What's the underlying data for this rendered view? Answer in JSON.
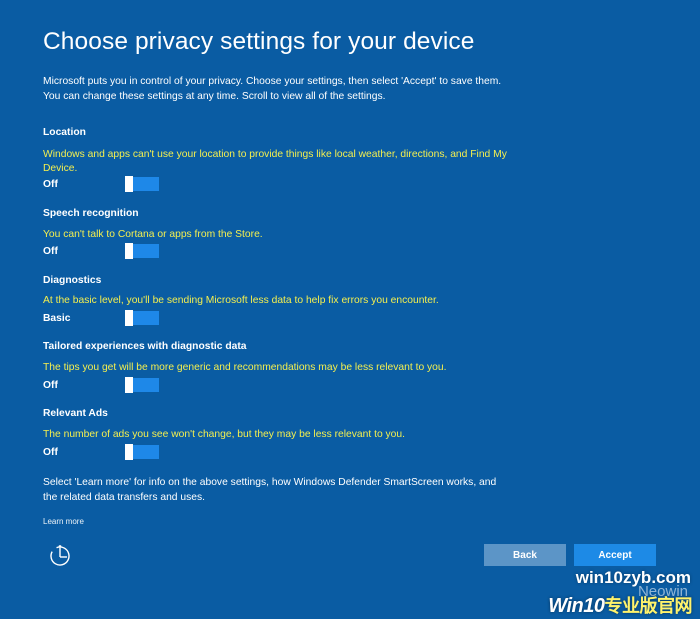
{
  "page": {
    "title": "Choose privacy settings for your device",
    "intro": "Microsoft puts you in control of your privacy. Choose your settings, then select 'Accept' to save them. You can change these settings at any time. Scroll to view all of the settings.",
    "footer_text": "Select 'Learn more' for info on the above settings, how Windows Defender SmartScreen works, and the related data transfers and uses.",
    "learn_more_label": "Learn more"
  },
  "settings": {
    "location": {
      "heading": "Location",
      "description": "Windows and apps can't use your location to provide things like local weather, directions, and Find My Device.",
      "state": "Off",
      "toggle_on": false
    },
    "speech": {
      "heading": "Speech recognition",
      "description": "You can't talk to Cortana or apps from the Store.",
      "state": "Off",
      "toggle_on": false
    },
    "diagnostics": {
      "heading": "Diagnostics",
      "description": "At the basic level, you'll be sending Microsoft less data to help fix errors you encounter.",
      "state": "Basic",
      "toggle_on": false
    },
    "tailored": {
      "heading": "Tailored experiences with diagnostic data",
      "description": "The tips you get will be more generic and recommendations may be less relevant to you.",
      "state": "Off",
      "toggle_on": false
    },
    "ads": {
      "heading": "Relevant Ads",
      "description": "The number of ads you see won't change, but they may be less relevant to you.",
      "state": "Off",
      "toggle_on": false
    }
  },
  "buttons": {
    "back_label": "Back",
    "accept_label": "Accept"
  },
  "icons": {
    "accessibility": "ease-of-access-icon"
  },
  "watermark": {
    "url": "win10zyb.com",
    "neowin": "Neowin",
    "brand_prefix": "Win10",
    "brand_cn": "专业版官网"
  },
  "colors": {
    "background": "#0a5ca3",
    "description_text": "#f4ef4f",
    "toggle_track": "#1e88e8",
    "back_button": "#5c95c7",
    "accept_button": "#1d8ae6"
  }
}
